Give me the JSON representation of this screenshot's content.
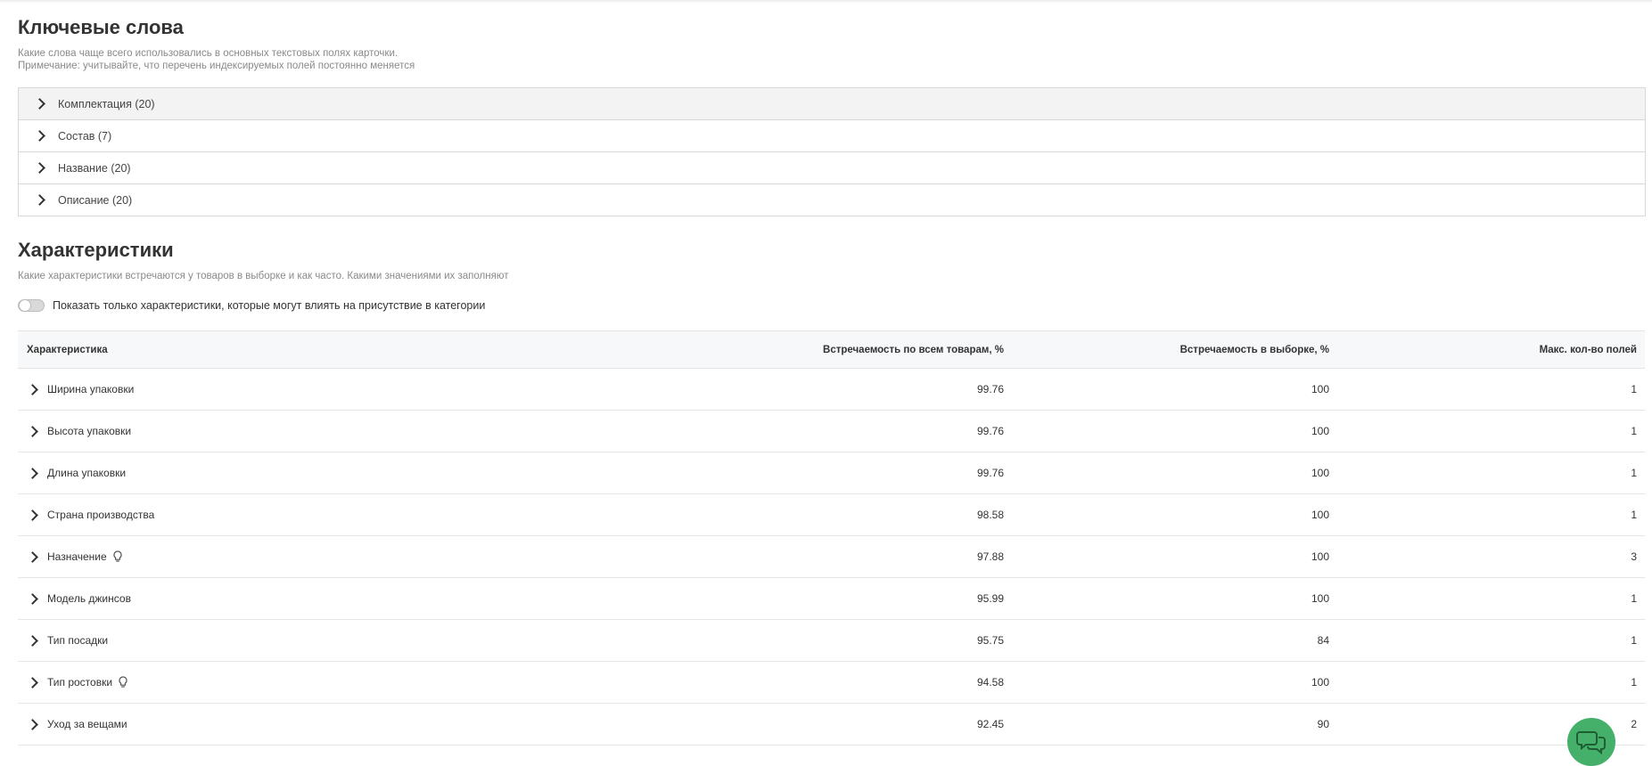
{
  "keywords": {
    "title": "Ключевые слова",
    "description_line1": "Какие слова чаще всего использовались в основных текстовых полях карточки.",
    "description_line2": "Примечание: учитывайте, что перечень индексируемых полей постоянно меняется",
    "items": [
      {
        "label": "Комплектация (20)"
      },
      {
        "label": "Состав (7)"
      },
      {
        "label": "Название (20)"
      },
      {
        "label": "Описание (20)"
      }
    ]
  },
  "characteristics": {
    "title": "Характеристики",
    "description": "Какие характеристики встречаются у товаров в выборке и как часто. Какими значениями их заполняют",
    "toggle_label": "Показать только характеристики, которые могут влиять на присутствие в категории",
    "table": {
      "headers": {
        "name": "Характеристика",
        "all_goods": "Встречаемость по всем товарам, %",
        "sample": "Встречаемость в выборке, %",
        "max_fields": "Макс. кол-во полей"
      },
      "rows": [
        {
          "name": "Ширина упаковки",
          "all_goods": "99.76",
          "sample": "100",
          "max_fields": "1",
          "hint": false
        },
        {
          "name": "Высота упаковки",
          "all_goods": "99.76",
          "sample": "100",
          "max_fields": "1",
          "hint": false
        },
        {
          "name": "Длина упаковки",
          "all_goods": "99.76",
          "sample": "100",
          "max_fields": "1",
          "hint": false
        },
        {
          "name": "Страна производства",
          "all_goods": "98.58",
          "sample": "100",
          "max_fields": "1",
          "hint": false
        },
        {
          "name": "Назначение",
          "all_goods": "97.88",
          "sample": "100",
          "max_fields": "3",
          "hint": true
        },
        {
          "name": "Модель джинсов",
          "all_goods": "95.99",
          "sample": "100",
          "max_fields": "1",
          "hint": false
        },
        {
          "name": "Тип посадки",
          "all_goods": "95.75",
          "sample": "84",
          "max_fields": "1",
          "hint": false
        },
        {
          "name": "Тип ростовки",
          "all_goods": "94.58",
          "sample": "100",
          "max_fields": "1",
          "hint": true
        },
        {
          "name": "Уход за вещами",
          "all_goods": "92.45",
          "sample": "90",
          "max_fields": "2",
          "hint": false
        }
      ]
    }
  },
  "icons": {
    "row_expand": "chevron-right-icon",
    "hint": "lightbulb-icon",
    "chat": "chat-bubbles-icon"
  },
  "colors": {
    "chat_button": "#45b06a",
    "header_bg": "#f7f8f9",
    "active_row_bg": "#f3f3f3"
  }
}
